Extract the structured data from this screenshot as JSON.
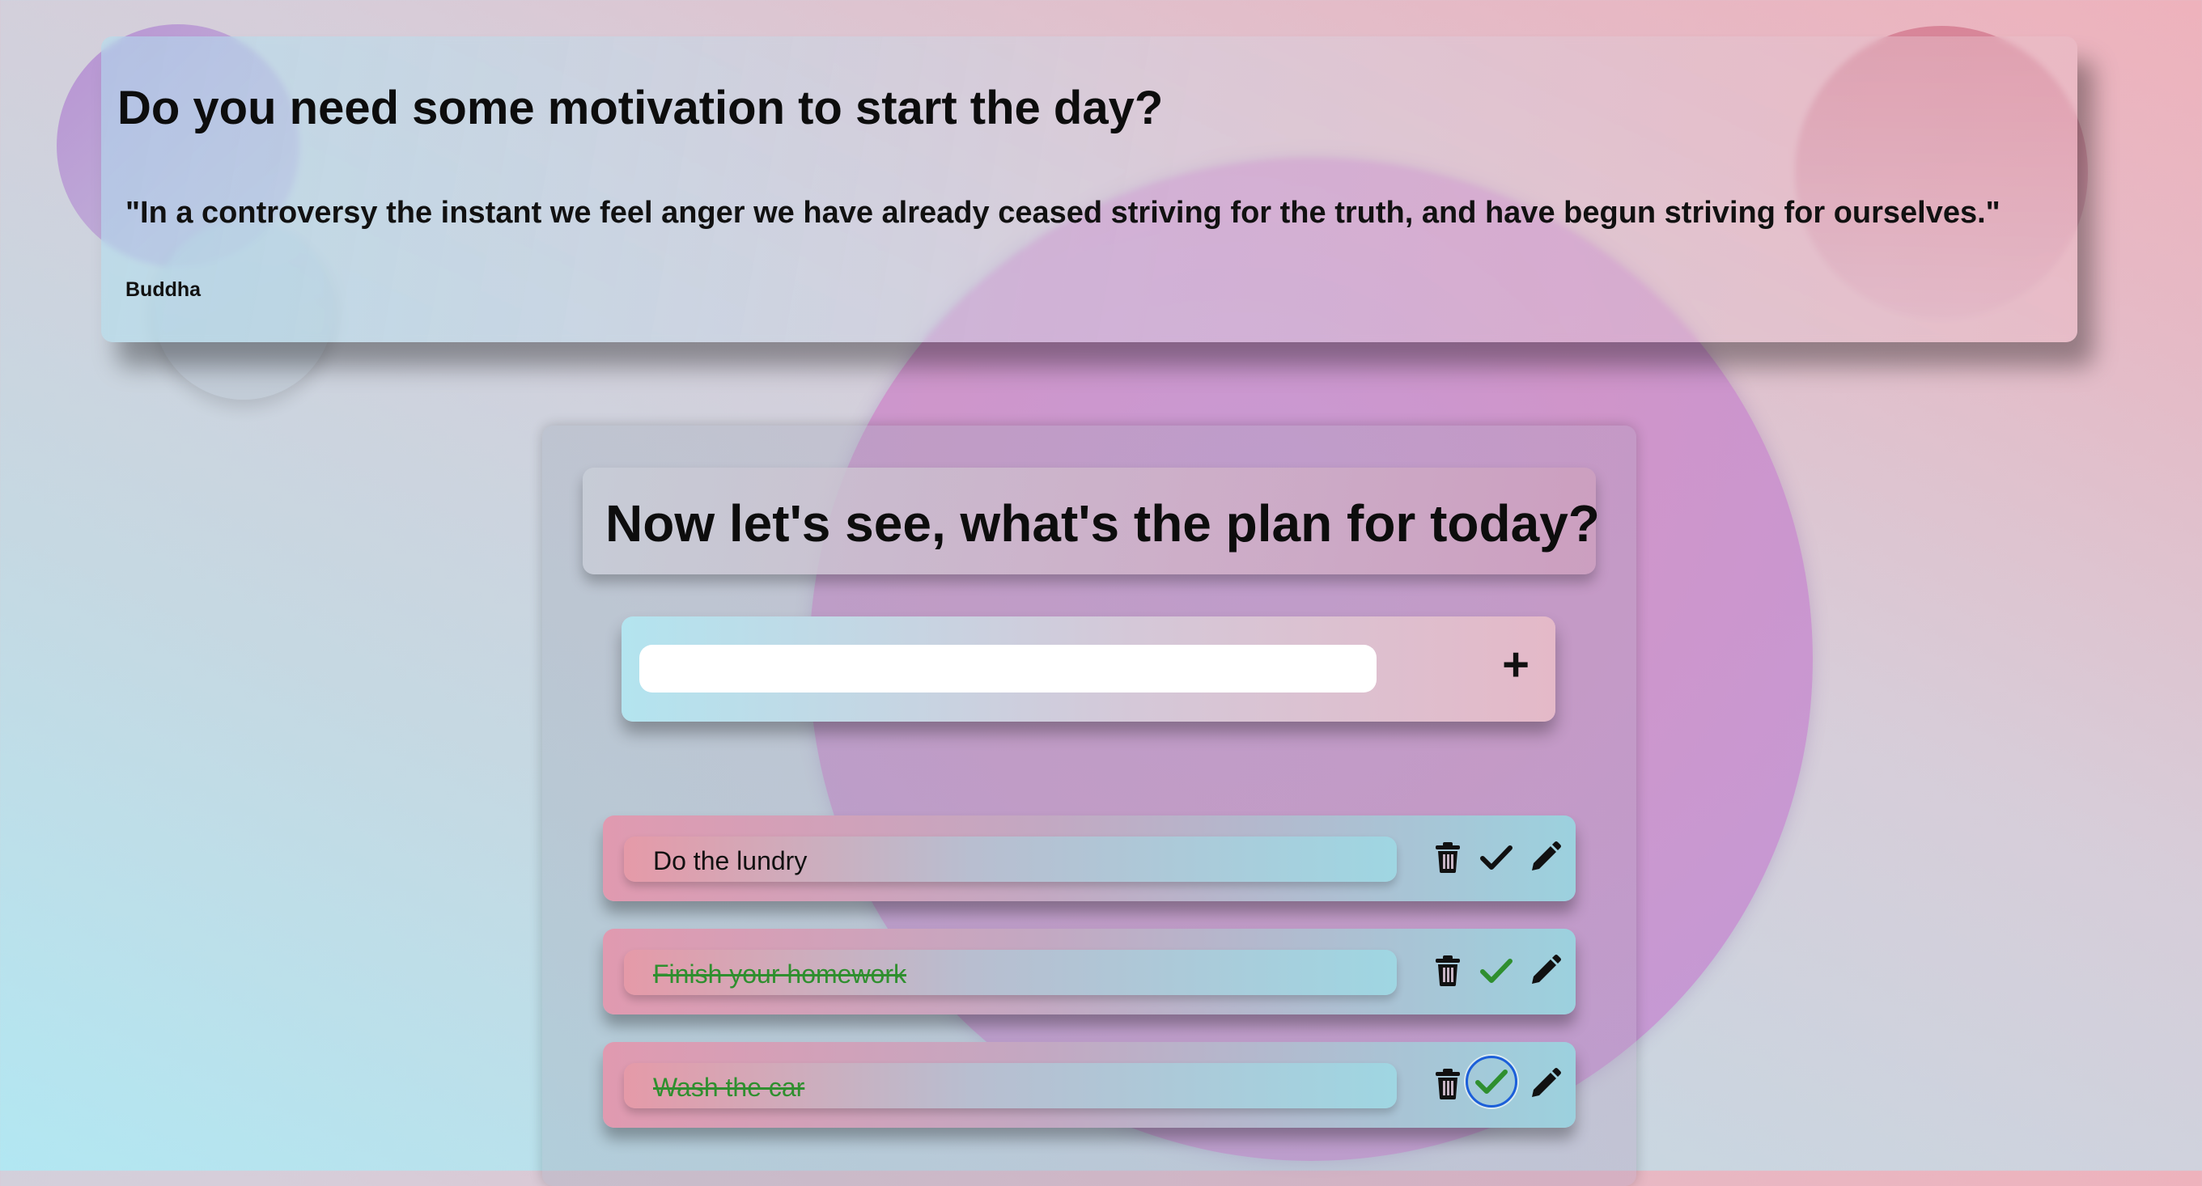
{
  "motivation": {
    "title": "Do you need some motivation to start the day?",
    "quote": "\"In a controversy the instant we feel anger we have already ceased striving for the truth, and have begun striving for ourselves.\"",
    "author": "Buddha"
  },
  "planner": {
    "title": "Now let's see, what's the plan for today?",
    "input_value": "",
    "add_label": "+",
    "tasks": [
      {
        "text": "Do the lundry",
        "done": false
      },
      {
        "text": "Finish your homework",
        "done": true
      },
      {
        "text": "Wash the car",
        "done": true
      }
    ]
  },
  "icons": {
    "delete": "trash-icon",
    "complete": "check-icon",
    "edit": "pencil-icon",
    "add": "plus-icon"
  },
  "colors": {
    "done_text": "#2f8f2f",
    "focus_ring": "#1c5fd9",
    "text": "#111111"
  }
}
